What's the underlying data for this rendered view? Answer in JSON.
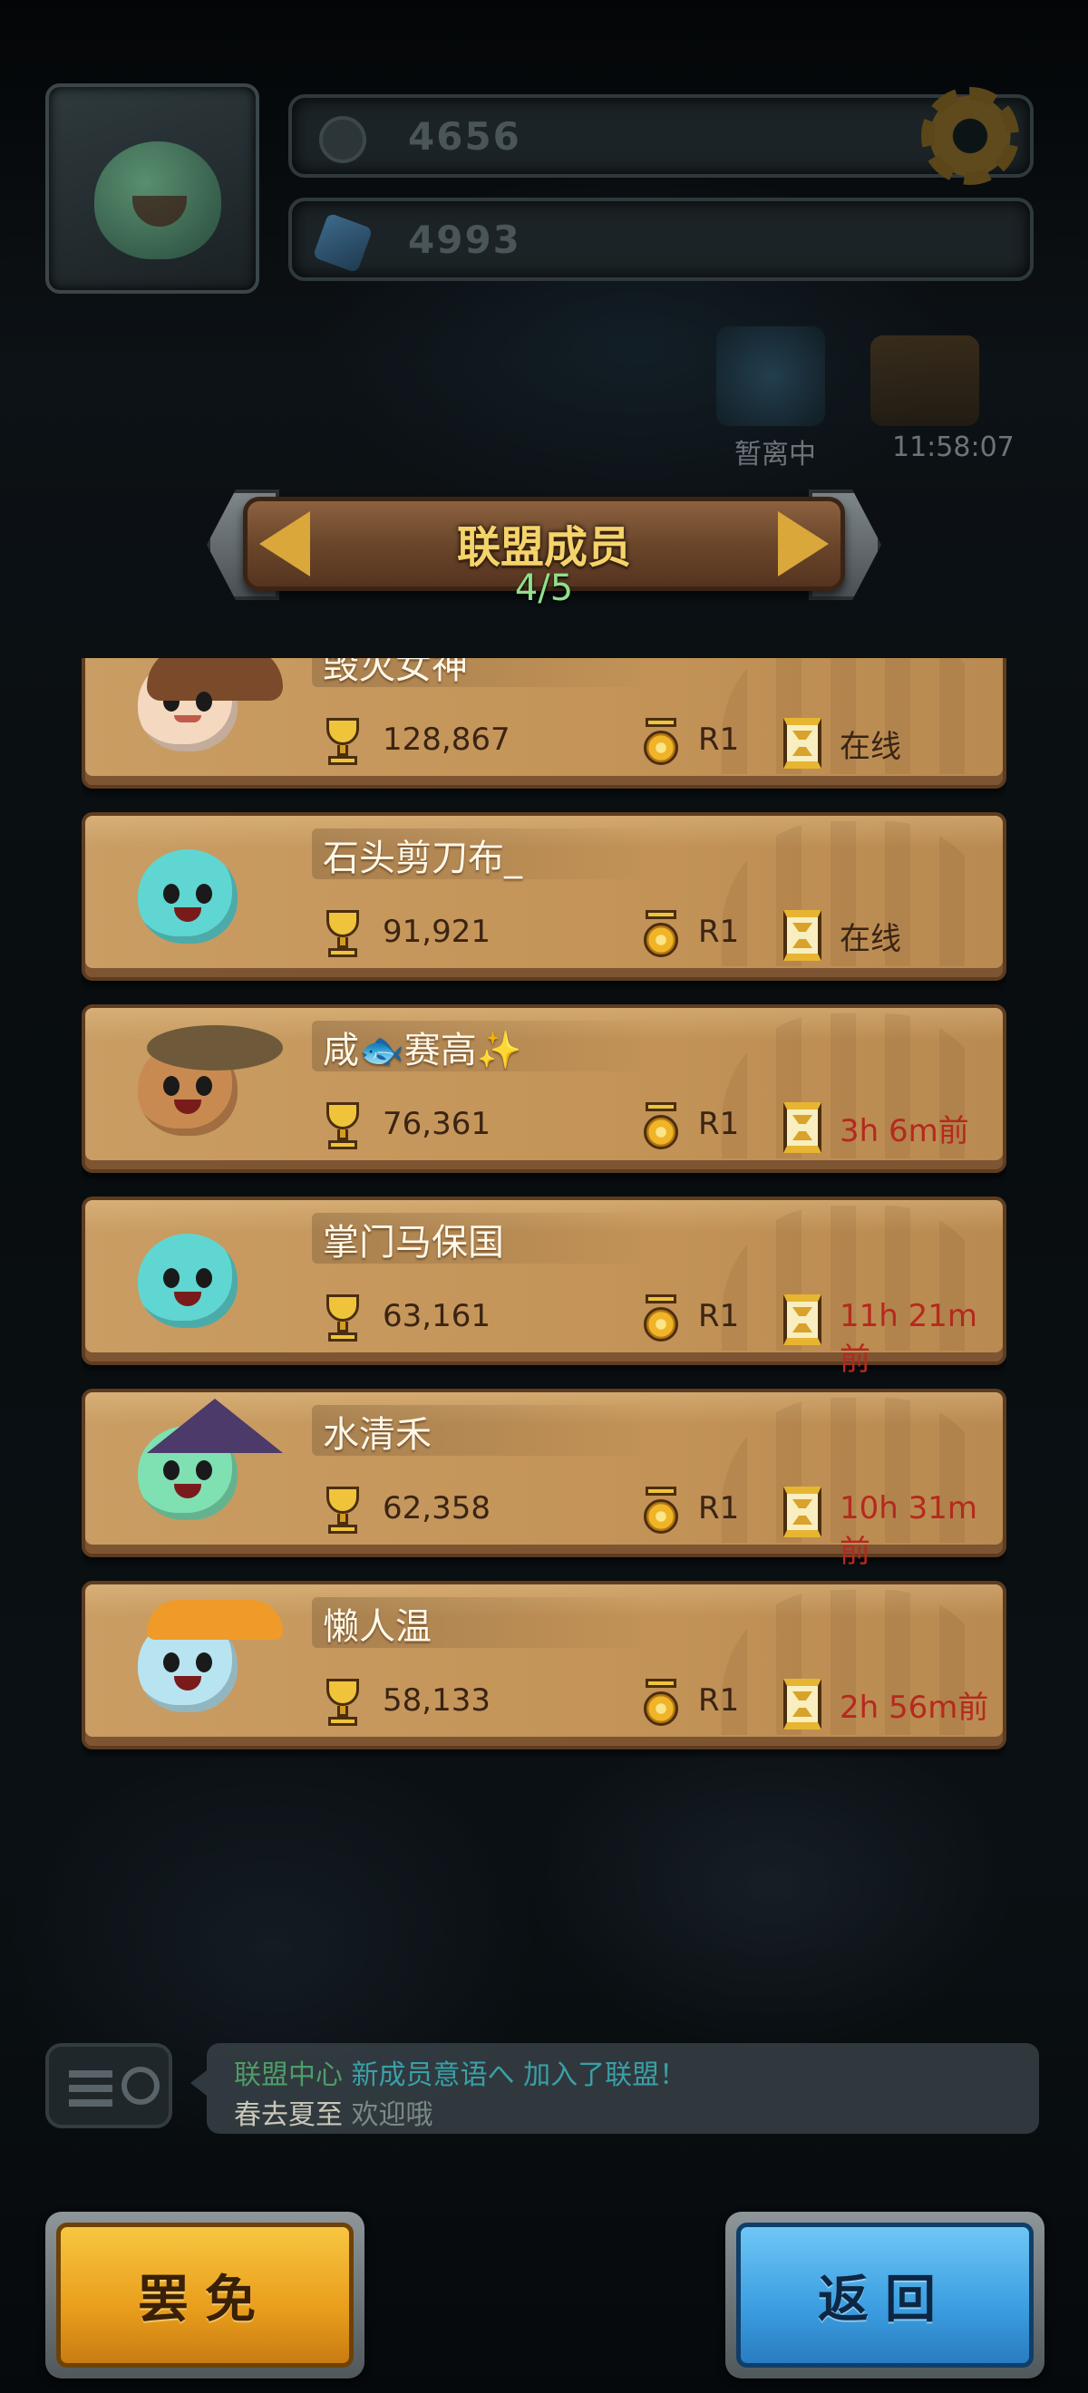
{
  "hud": {
    "coins": "4656",
    "gems": "4993",
    "away_label": "暂离中",
    "clock": "11:58:07"
  },
  "banner": {
    "title": "联盟成员",
    "count": "4/5"
  },
  "stat_colors": {
    "online": "#3a2414",
    "offline": "#b5291e"
  },
  "members": [
    {
      "name": "毁灭女神",
      "trophies": "128,867",
      "rank": "R1",
      "status": "在线",
      "online": true
    },
    {
      "name": "石头剪刀布_",
      "trophies": "91,921",
      "rank": "R1",
      "status": "在线",
      "online": true
    },
    {
      "name": "咸🐟赛高✨",
      "trophies": "76,361",
      "rank": "R1",
      "status": "3h 6m前",
      "online": false
    },
    {
      "name": "掌门马保国",
      "trophies": "63,161",
      "rank": "R1",
      "status": "11h 21m前",
      "online": false
    },
    {
      "name": "水清禾",
      "trophies": "62,358",
      "rank": "R1",
      "status": "10h 31m前",
      "online": false
    },
    {
      "name": "懒人温",
      "trophies": "58,133",
      "rank": "R1",
      "status": "2h 56m前",
      "online": false
    }
  ],
  "chat": {
    "line1_sender": "联盟中心",
    "line1_user": "新成员意语へ",
    "line1_text": "加入了联盟！",
    "line2_sender": "春去夏至",
    "line2_text": "欢迎哦"
  },
  "buttons": {
    "dismiss": "罢免",
    "back": "返回"
  }
}
